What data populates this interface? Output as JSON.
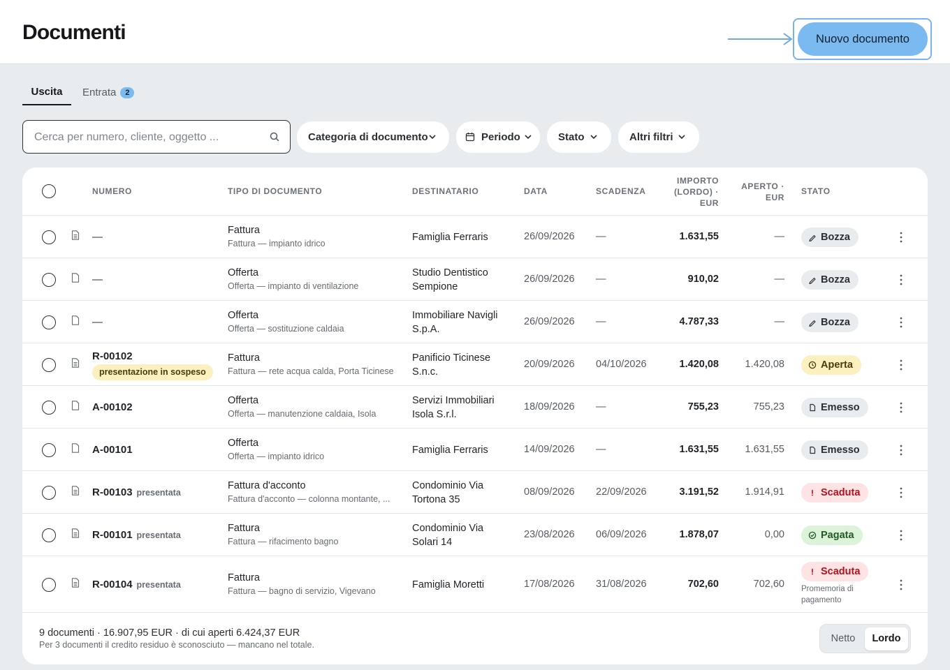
{
  "header": {
    "title": "Documenti",
    "new_button_label": "Nuovo documento"
  },
  "tabs": [
    {
      "label": "Uscita",
      "active": true
    },
    {
      "label": "Entrata",
      "badge": "2",
      "active": false
    }
  ],
  "search": {
    "placeholder": "Cerca per numero, cliente, oggetto ...",
    "value": "",
    "icon": "search-icon"
  },
  "filters": [
    {
      "label": "Categoria di documento",
      "icon": "chevron-down-icon"
    },
    {
      "label": "Periodo",
      "icon": "calendar-icon"
    },
    {
      "label": "Stato",
      "icon": "chevron-down-icon"
    },
    {
      "label": "Altri filtri",
      "icon": "chevron-down-icon"
    }
  ],
  "table": {
    "columns": {
      "numero": "NUMERO",
      "tipo": "TIPO DI DOCUMENTO",
      "destinatario": "DESTINATARIO",
      "data": "DATA",
      "scadenza": "SCADENZA",
      "importo_1": "IMPORTO",
      "importo_2": "(LORDO) ·",
      "importo_3": "EUR",
      "aperto_1": "APERTO ·",
      "aperto_2": "EUR",
      "stato": "STATO"
    },
    "rows": [
      {
        "numero": "—",
        "numero_sub": "",
        "badge": "",
        "tipo": "Fattura",
        "tipo_sub": "Fattura — impianto idrico",
        "destinatario": "Famiglia Ferraris",
        "data": "26/09/2026",
        "scadenza": "—",
        "importo": "1.631,55",
        "aperto": "—",
        "stato": "Bozza",
        "stato_kind": "draft",
        "stato_note": ""
      },
      {
        "numero": "—",
        "numero_sub": "",
        "badge": "",
        "tipo": "Offerta",
        "tipo_sub": "Offerta — impianto di ventilazione",
        "destinatario": "Studio Dentistico Sempione",
        "data": "26/09/2026",
        "scadenza": "—",
        "importo": "910,02",
        "aperto": "—",
        "stato": "Bozza",
        "stato_kind": "draft",
        "stato_note": ""
      },
      {
        "numero": "—",
        "numero_sub": "",
        "badge": "",
        "tipo": "Offerta",
        "tipo_sub": "Offerta — sostituzione caldaia",
        "destinatario": "Immobiliare Navigli S.p.A.",
        "data": "26/09/2026",
        "scadenza": "—",
        "importo": "4.787,33",
        "aperto": "—",
        "stato": "Bozza",
        "stato_kind": "draft",
        "stato_note": ""
      },
      {
        "numero": "R-00102",
        "numero_sub": "",
        "badge": "presentazione in sospeso",
        "tipo": "Fattura",
        "tipo_sub": "Fattura — rete acqua calda, Porta Ticinese",
        "destinatario": "Panificio Ticinese S.n.c.",
        "data": "20/09/2026",
        "scadenza": "04/10/2026",
        "importo": "1.420,08",
        "aperto": "1.420,08",
        "stato": "Aperta",
        "stato_kind": "open",
        "stato_note": ""
      },
      {
        "numero": "A-00102",
        "numero_sub": "",
        "badge": "",
        "tipo": "Offerta",
        "tipo_sub": "Offerta — manutenzione caldaia, Isola",
        "destinatario": "Servizi Immobiliari Isola S.r.l.",
        "data": "18/09/2026",
        "scadenza": "—",
        "importo": "755,23",
        "aperto": "755,23",
        "stato": "Emesso",
        "stato_kind": "issued",
        "stato_note": ""
      },
      {
        "numero": "A-00101",
        "numero_sub": "",
        "badge": "",
        "tipo": "Offerta",
        "tipo_sub": "Offerta — impianto idrico",
        "destinatario": "Famiglia Ferraris",
        "data": "14/09/2026",
        "scadenza": "—",
        "importo": "1.631,55",
        "aperto": "1.631,55",
        "stato": "Emesso",
        "stato_kind": "issued",
        "stato_note": ""
      },
      {
        "numero": "R-00103",
        "numero_sub": "presentata",
        "badge": "",
        "tipo": "Fattura d'acconto",
        "tipo_sub": "Fattura d'acconto — colonna montante, ...",
        "destinatario": "Condominio Via Tortona 35",
        "data": "08/09/2026",
        "scadenza": "22/09/2026",
        "importo": "3.191,52",
        "aperto": "1.914,91",
        "stato": "Scaduta",
        "stato_kind": "overdue",
        "stato_note": ""
      },
      {
        "numero": "R-00101",
        "numero_sub": "presentata",
        "badge": "",
        "tipo": "Fattura",
        "tipo_sub": "Fattura — rifacimento bagno",
        "destinatario": "Condominio Via Solari 14",
        "data": "23/08/2026",
        "scadenza": "06/09/2026",
        "importo": "1.878,07",
        "aperto": "0,00",
        "stato": "Pagata",
        "stato_kind": "paid",
        "stato_note": ""
      },
      {
        "numero": "R-00104",
        "numero_sub": "presentata",
        "badge": "",
        "tipo": "Fattura",
        "tipo_sub": "Fattura — bagno di servizio, Vigevano",
        "destinatario": "Famiglia Moretti",
        "data": "17/08/2026",
        "scadenza": "31/08/2026",
        "importo": "702,60",
        "aperto": "702,60",
        "stato": "Scaduta",
        "stato_kind": "overdue",
        "stato_note": "Promemoria di pagamento"
      }
    ]
  },
  "status_styles": {
    "draft": {
      "bg": "#e9ecef",
      "fg": "#2b2f33",
      "icon": "pencil-icon"
    },
    "open": {
      "bg": "#fcefc0",
      "fg": "#4a3a0c",
      "icon": "clock-icon"
    },
    "issued": {
      "bg": "#e9ecef",
      "fg": "#2b2f33",
      "icon": "document-icon"
    },
    "overdue": {
      "bg": "#fde3e4",
      "fg": "#b3121d",
      "icon": "exclamation-icon"
    },
    "paid": {
      "bg": "#dcf3da",
      "fg": "#1f5a22",
      "icon": "check-circle-icon"
    }
  },
  "footer": {
    "summary": "9 documenti · 16.907,95 EUR · di cui aperti 6.424,37 EUR",
    "note": "Per 3 documenti il credito residuo è sconosciuto — mancano nel totale.",
    "toggle": [
      {
        "label": "Netto",
        "selected": false
      },
      {
        "label": "Lordo",
        "selected": true
      }
    ]
  },
  "colors": {
    "accent": "#7bbaf0",
    "accent_ring": "#78b4ea",
    "page_bg": "#e9ecef"
  }
}
